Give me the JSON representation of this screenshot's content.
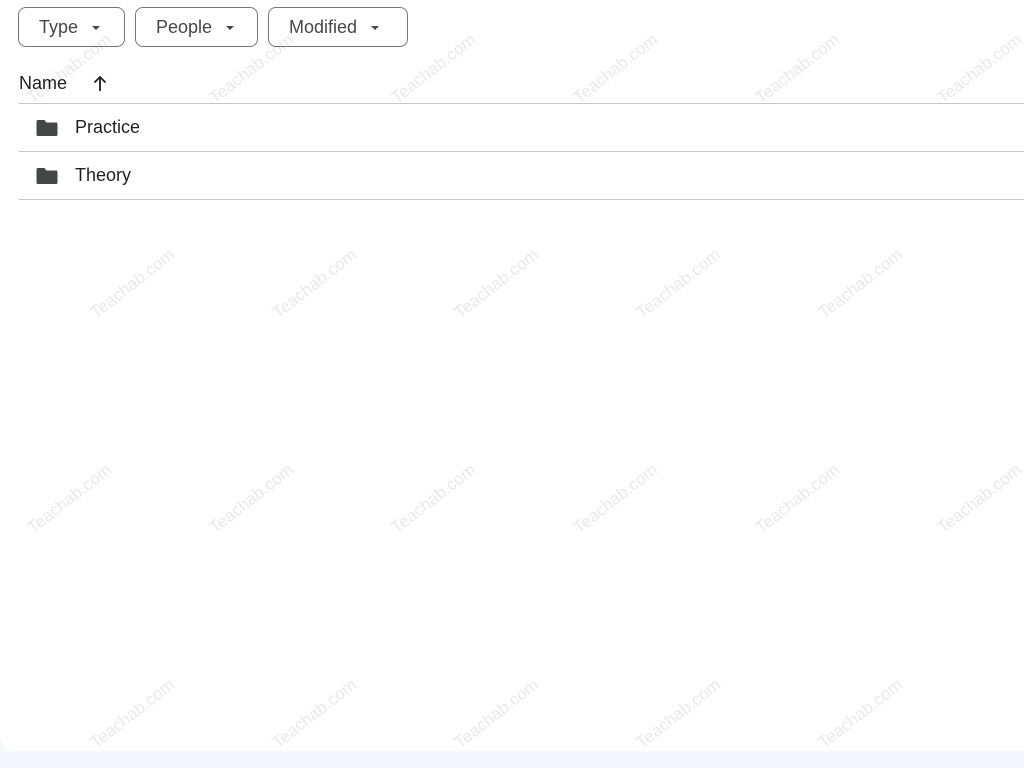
{
  "filters": [
    {
      "label": "Type",
      "icon": "caret-down-icon"
    },
    {
      "label": "People",
      "icon": "caret-down-icon"
    },
    {
      "label": "Modified",
      "icon": "caret-down-icon"
    }
  ],
  "header": {
    "name_label": "Name",
    "sort_icon": "arrow-up-icon"
  },
  "rows": [
    {
      "icon": "folder-icon",
      "name": "Practice"
    },
    {
      "icon": "folder-icon",
      "name": "Theory"
    }
  ],
  "watermark": {
    "text": "Teachab.com"
  },
  "colors": {
    "chip_border": "#747775",
    "divider": "#c7c7c7",
    "folder": "#444746",
    "page_bg": "#f4f7fb"
  }
}
